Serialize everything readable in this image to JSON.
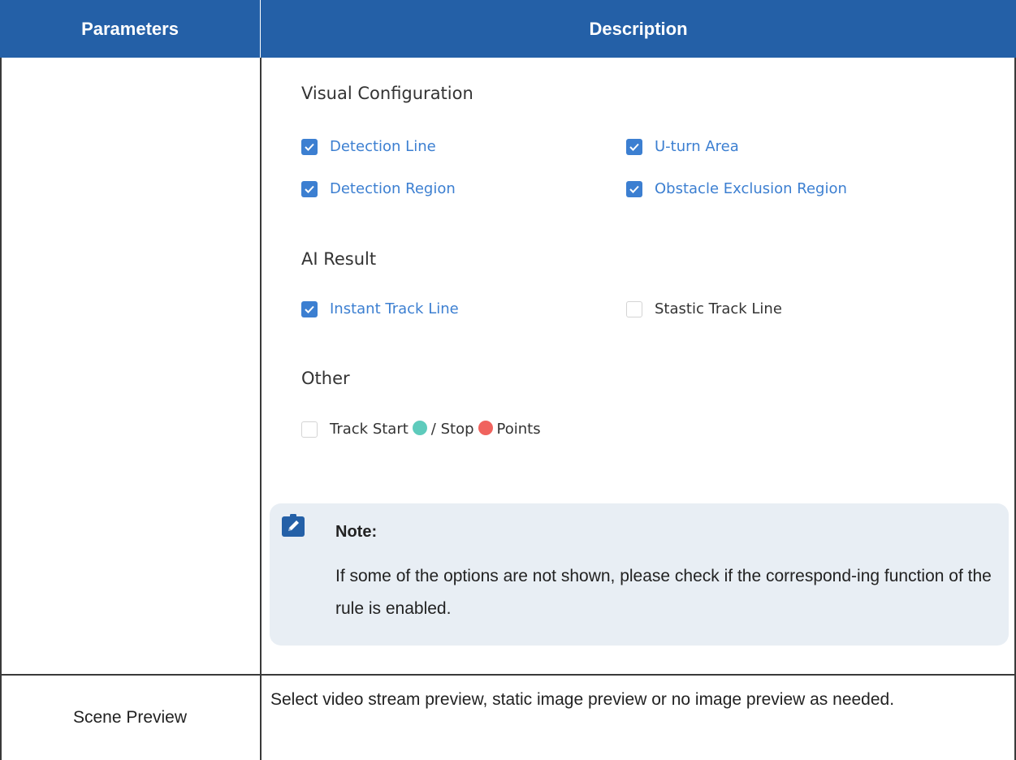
{
  "header": {
    "parameters": "Parameters",
    "description": "Description"
  },
  "visual_configuration": {
    "title": "Visual Configuration",
    "options": [
      {
        "label": "Detection Line",
        "checked": true
      },
      {
        "label": "U-turn Area",
        "checked": true
      },
      {
        "label": "Detection Region",
        "checked": true
      },
      {
        "label": "Obstacle Exclusion Region",
        "checked": true
      }
    ]
  },
  "ai_result": {
    "title": "AI Result",
    "options": [
      {
        "label": "Instant Track Line",
        "checked": true
      },
      {
        "label": "Stastic Track Line",
        "checked": false
      }
    ]
  },
  "other": {
    "title": "Other",
    "option": {
      "label_start": "Track Start",
      "label_mid": "/ Stop",
      "label_end": "Points",
      "checked": false,
      "start_color": "#5ecbbc",
      "stop_color": "#f0635e"
    }
  },
  "note": {
    "icon": "pencil-icon",
    "title": "Note:",
    "body": "If some of the options are not shown, please check if the correspond-ing function of the rule is enabled."
  },
  "row2": {
    "parameter": "Scene Preview",
    "description": "Select video stream preview, static image preview or no image preview as needed."
  },
  "colors": {
    "header_bg": "#2460a7",
    "accent": "#3c7fd1",
    "note_bg": "#e8eef4"
  }
}
